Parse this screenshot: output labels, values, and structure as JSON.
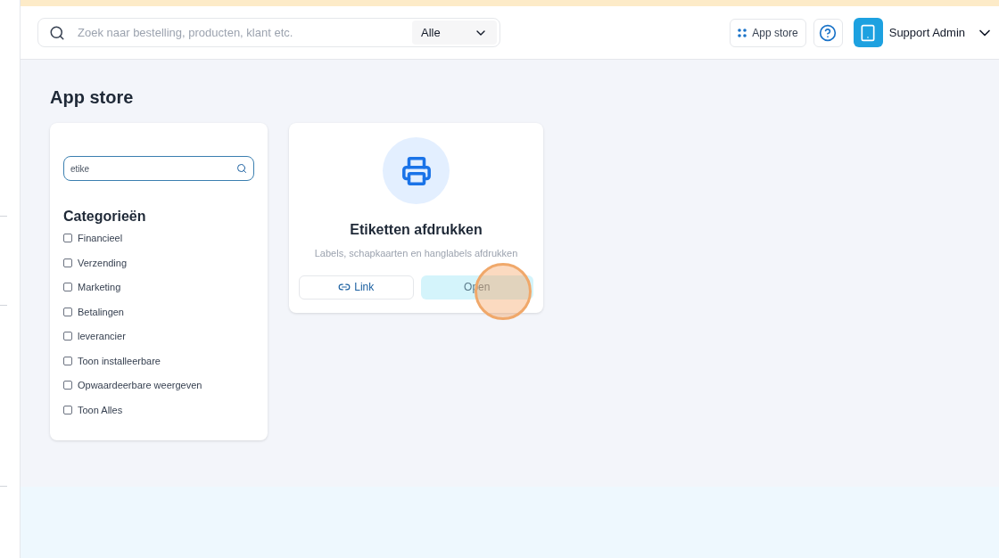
{
  "header": {
    "search": {
      "placeholder": "Zoek naar bestelling, producten, klant etc.",
      "scope": "Alle"
    },
    "app_store_button": "App store",
    "user": "Support Admin"
  },
  "page_title": "App store",
  "filter": {
    "search_value": "etike",
    "heading": "Categorieën",
    "categories": [
      {
        "label": "Financieel",
        "checked": false
      },
      {
        "label": "Verzending",
        "checked": false
      },
      {
        "label": "Marketing",
        "checked": false
      },
      {
        "label": "Betalingen",
        "checked": false
      },
      {
        "label": "leverancier",
        "checked": false
      },
      {
        "label": "Toon installeerbare",
        "checked": false
      },
      {
        "label": "Opwaardeerbare weergeven",
        "checked": false
      },
      {
        "label": "Toon Alles",
        "checked": false
      }
    ]
  },
  "apps": [
    {
      "title": "Etiketten afdrukken",
      "description": "Labels, schapkaarten en hanglabels afdrukken",
      "link_button": "Link",
      "open_button": "Open"
    }
  ]
}
